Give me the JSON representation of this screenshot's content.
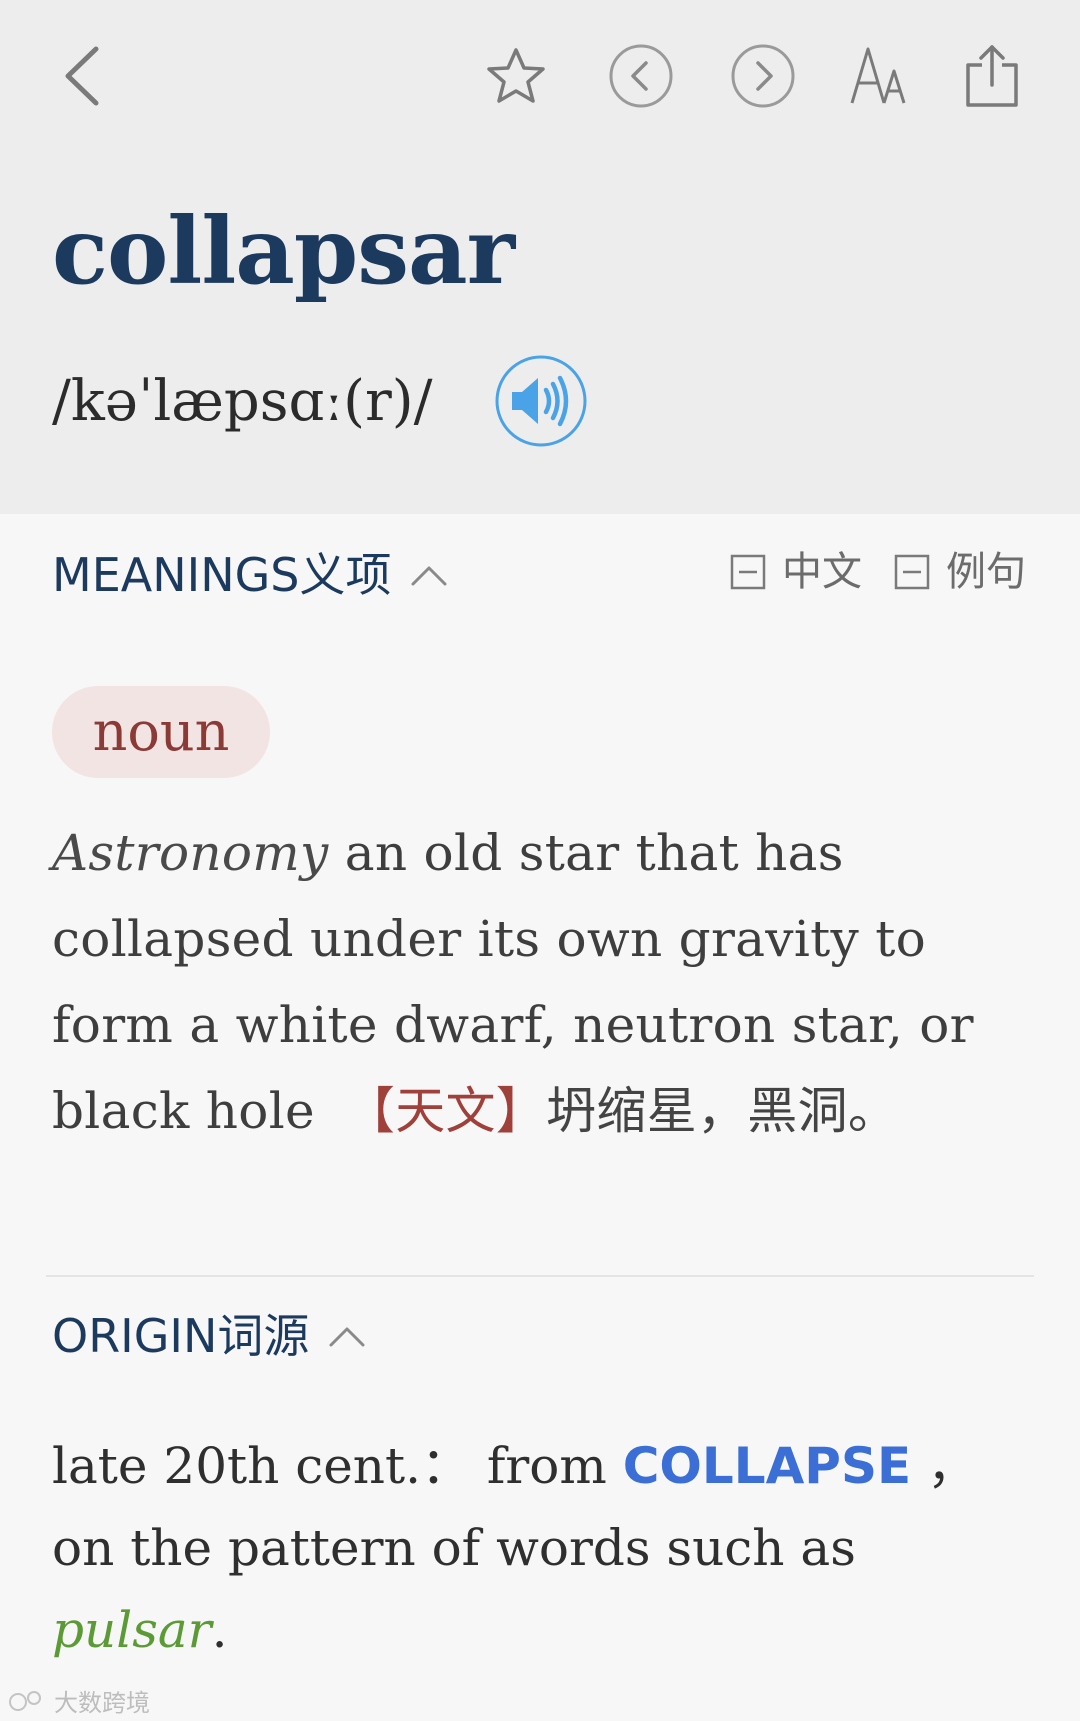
{
  "toolbar": {
    "back_icon": "chevron-left-icon",
    "favorite_icon": "star-outline-icon",
    "prev_icon": "circle-chevron-left-icon",
    "next_icon": "circle-chevron-right-icon",
    "font_size_icon": "font-size-icon",
    "share_icon": "share-icon",
    "font_size_label": "A"
  },
  "entry": {
    "headword": "collapsar",
    "pronunciation": "/kəˈlæpsɑː(r)/",
    "audio_icon": "speaker-icon"
  },
  "meanings": {
    "title": "MEANINGS义项",
    "toggle_chinese": "中文",
    "toggle_examples": "例句",
    "part_of_speech": "noun",
    "subject": "Astronomy",
    "definition": "an old star that has collapsed under its own gravity to form a white dwarf, neutron star, or black hole",
    "chinese_tag": "【天文】",
    "chinese_definition": "坍缩星，黑洞。"
  },
  "origin": {
    "title": "ORIGIN词源",
    "prefix": "late 20th cent.： from ",
    "xref": "COLLAPSE",
    "middle": " ，on the pattern of words such as ",
    "example": "pulsar",
    "suffix": "."
  },
  "watermark": {
    "text": "大数跨境"
  },
  "colors": {
    "header_bg": "#ededee",
    "page_bg": "#f7f7f7",
    "headword": "#1c3a5e",
    "accent_blue": "#3b6fd6",
    "audio_blue": "#4aa3e6",
    "pos_pill_bg": "#f3e4e4",
    "pos_text": "#8c3a36",
    "example_green": "#5b9a35"
  }
}
